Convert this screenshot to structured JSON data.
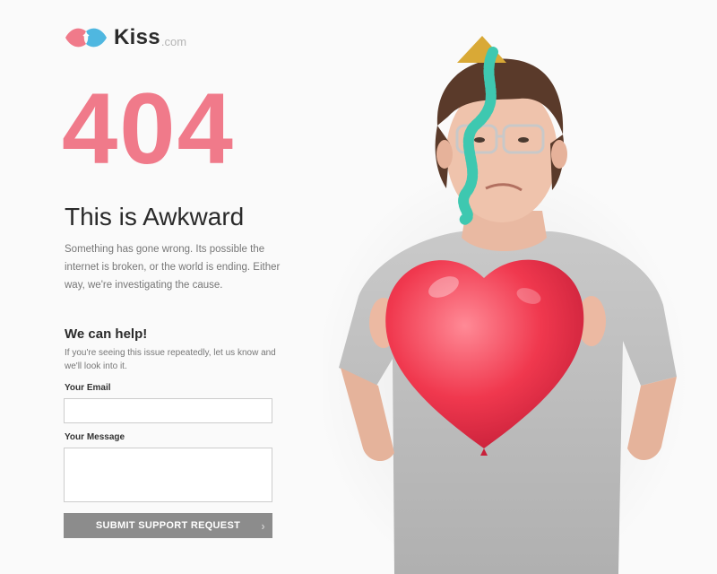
{
  "brand": {
    "name": "Kiss",
    "tld": ".com",
    "colors": {
      "pink": "#f07a8a",
      "blue": "#4fb7e0"
    }
  },
  "error": {
    "code": "404",
    "headline": "This is Awkward",
    "description": "Something has gone wrong. Its possible the internet is broken, or the world is ending. Either way, we're investigating the cause."
  },
  "help": {
    "title": "We can help!",
    "text": "If you're seeing this issue repeatedly, let us know and we'll look into it."
  },
  "form": {
    "email_label": "Your Email",
    "email_value": "",
    "message_label": "Your Message",
    "message_value": "",
    "submit_label": "SUBMIT SUPPORT REQUEST",
    "submit_icon": "chevron-right-icon"
  },
  "photo": {
    "subject": "person-with-heart-balloon-and-party-hat"
  }
}
